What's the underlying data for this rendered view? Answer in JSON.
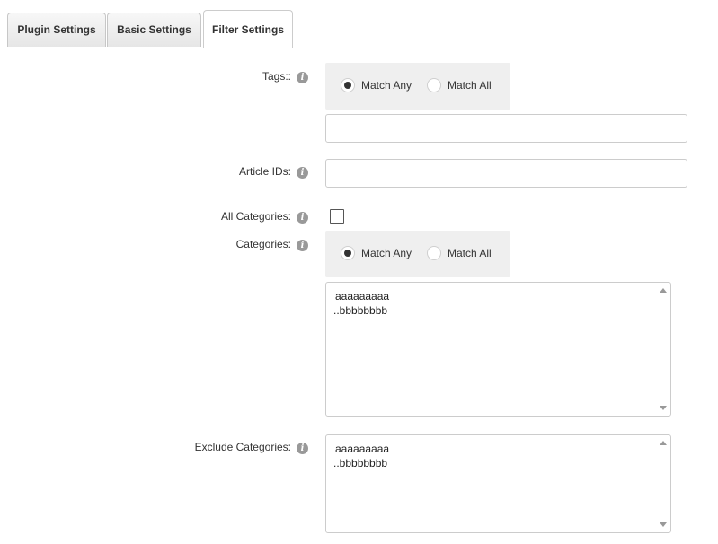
{
  "tabs": [
    {
      "label": "Plugin Settings",
      "active": false
    },
    {
      "label": "Basic Settings",
      "active": false
    },
    {
      "label": "Filter Settings",
      "active": true
    }
  ],
  "form": {
    "tags": {
      "label": "Tags::",
      "match_any": "Match Any",
      "match_all": "Match All",
      "selected": "Match Any",
      "value": ""
    },
    "article_ids": {
      "label": "Article IDs:",
      "value": ""
    },
    "all_categories": {
      "label": "All Categories:",
      "checked": false
    },
    "categories": {
      "label": "Categories:",
      "match_any": "Match Any",
      "match_all": "Match All",
      "selected": "Match Any",
      "options": [
        "aaaaaaaaa",
        "..bbbbbbbb"
      ]
    },
    "exclude_categories": {
      "label": "Exclude Categories:",
      "options": [
        "aaaaaaaaa",
        "..bbbbbbbb"
      ]
    }
  },
  "icons": {
    "info": "info-icon",
    "info_glyph": "i"
  },
  "colors": {
    "radio_group_bg": "#efefef",
    "info_icon": "#999999",
    "border": "#cccccc"
  }
}
